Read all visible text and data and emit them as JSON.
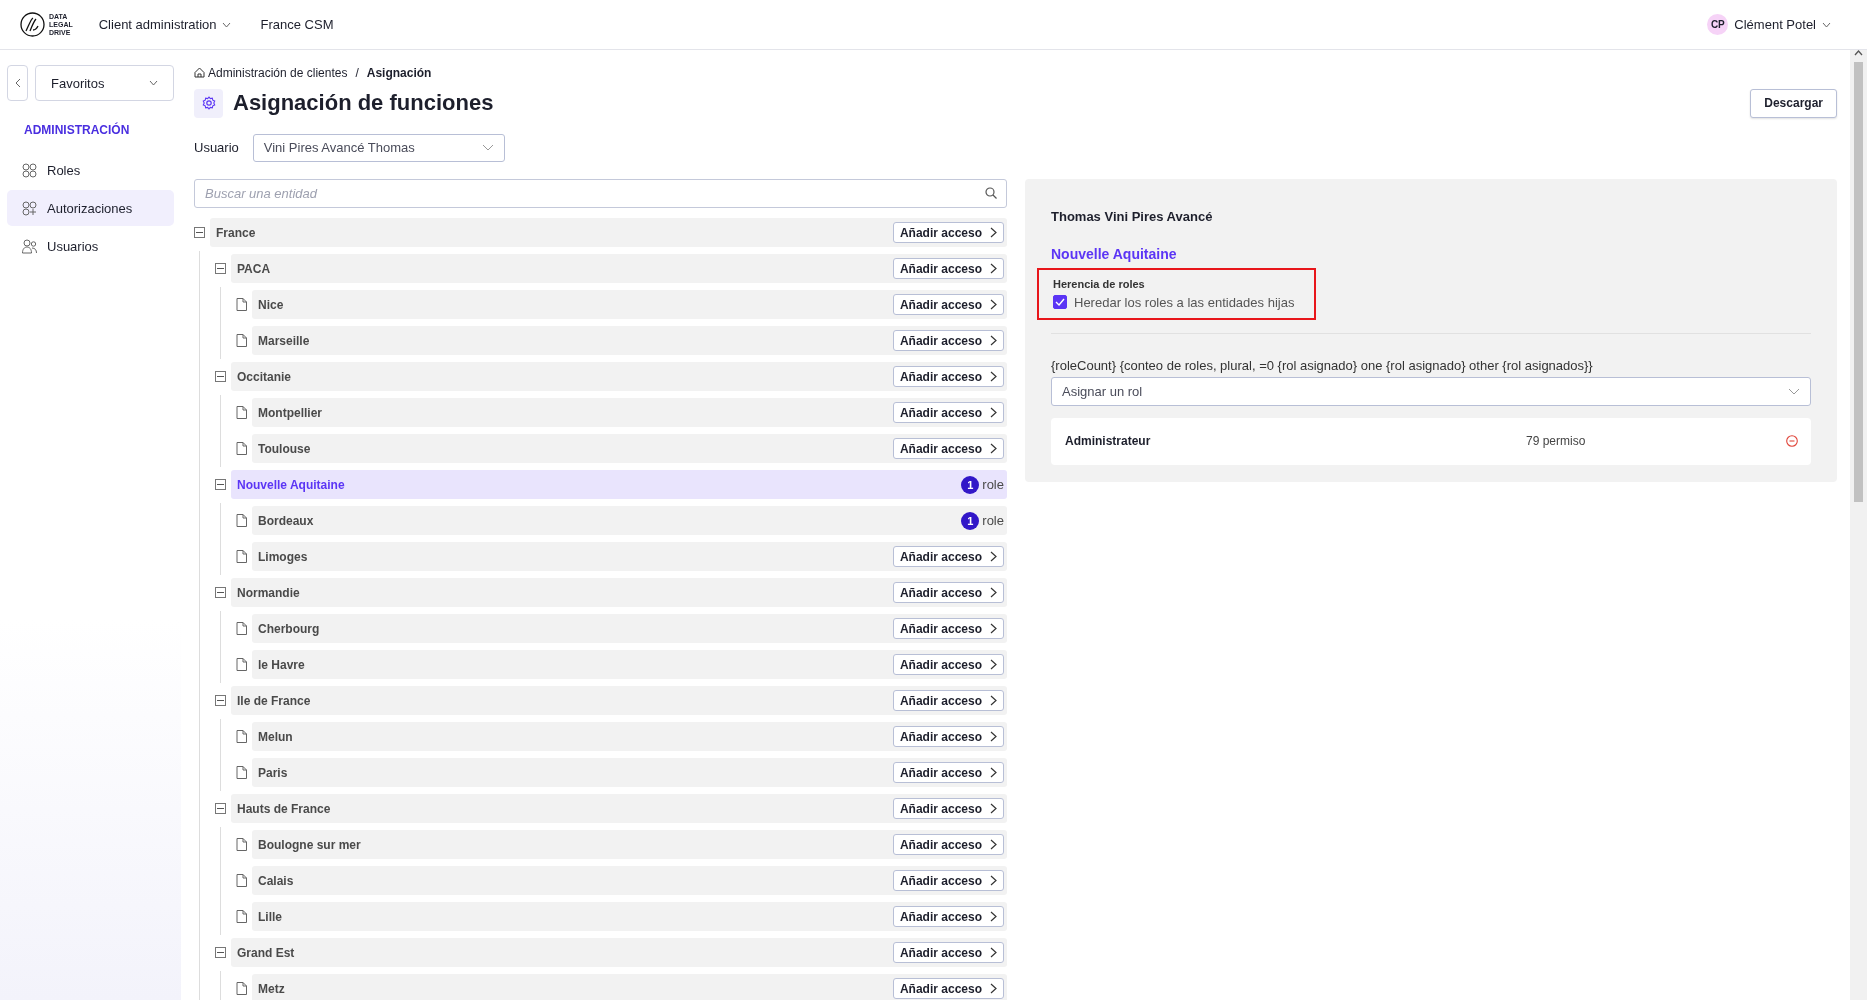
{
  "header": {
    "logo": [
      "DATA",
      "LEGAL",
      "DRIVE"
    ],
    "nav": [
      {
        "label": "Client administration",
        "dropdown": true
      },
      {
        "label": "France CSM",
        "dropdown": false
      }
    ],
    "user": {
      "initials": "CP",
      "name": "Clément Potel"
    }
  },
  "sidebar": {
    "favorites": "Favoritos",
    "section": "ADMINISTRACIÓN",
    "items": [
      {
        "label": "Roles",
        "kind": "roles",
        "selected": false
      },
      {
        "label": "Autorizaciones",
        "kind": "auth",
        "selected": true
      },
      {
        "label": "Usuarios",
        "kind": "users",
        "selected": false
      }
    ]
  },
  "breadcrumb": {
    "items": [
      "Administración de clientes",
      "Asignación"
    ],
    "separator": "/"
  },
  "title": "Asignación de funciones",
  "download_button": "Descargar",
  "user_select": {
    "label": "Usuario",
    "value": "Vini Pires Avancé Thomas"
  },
  "search": {
    "placeholder": "Buscar una entidad"
  },
  "tree": [
    {
      "label": "France",
      "kind": "group",
      "expanded": true,
      "selected": false,
      "action": {
        "kind": "button",
        "label": "Añadir acceso"
      },
      "children": [
        {
          "label": "PACA",
          "kind": "group",
          "expanded": true,
          "selected": false,
          "action": {
            "kind": "button",
            "label": "Añadir acceso"
          },
          "children": [
            {
              "label": "Nice",
              "kind": "leaf",
              "selected": false,
              "action": {
                "kind": "button",
                "label": "Añadir acceso"
              }
            },
            {
              "label": "Marseille",
              "kind": "leaf",
              "selected": false,
              "action": {
                "kind": "button",
                "label": "Añadir acceso"
              }
            }
          ]
        },
        {
          "label": "Occitanie",
          "kind": "group",
          "expanded": true,
          "selected": false,
          "action": {
            "kind": "button",
            "label": "Añadir acceso"
          },
          "children": [
            {
              "label": "Montpellier",
              "kind": "leaf",
              "selected": false,
              "action": {
                "kind": "button",
                "label": "Añadir acceso"
              }
            },
            {
              "label": "Toulouse",
              "kind": "leaf",
              "selected": false,
              "action": {
                "kind": "button",
                "label": "Añadir acceso"
              }
            }
          ]
        },
        {
          "label": "Nouvelle Aquitaine",
          "kind": "group",
          "expanded": true,
          "selected": true,
          "action": {
            "kind": "count",
            "count": "1",
            "unit": "role"
          },
          "children": [
            {
              "label": "Bordeaux",
              "kind": "leaf",
              "selected": false,
              "action": {
                "kind": "count",
                "count": "1",
                "unit": "role"
              }
            },
            {
              "label": "Limoges",
              "kind": "leaf",
              "selected": false,
              "action": {
                "kind": "button",
                "label": "Añadir acceso"
              }
            }
          ]
        },
        {
          "label": "Normandie",
          "kind": "group",
          "expanded": true,
          "selected": false,
          "action": {
            "kind": "button",
            "label": "Añadir acceso"
          },
          "children": [
            {
              "label": "Cherbourg",
              "kind": "leaf",
              "selected": false,
              "action": {
                "kind": "button",
                "label": "Añadir acceso"
              }
            },
            {
              "label": "le Havre",
              "kind": "leaf",
              "selected": false,
              "action": {
                "kind": "button",
                "label": "Añadir acceso"
              }
            }
          ]
        },
        {
          "label": "Ile de France",
          "kind": "group",
          "expanded": true,
          "selected": false,
          "action": {
            "kind": "button",
            "label": "Añadir acceso"
          },
          "children": [
            {
              "label": "Melun",
              "kind": "leaf",
              "selected": false,
              "action": {
                "kind": "button",
                "label": "Añadir acceso"
              }
            },
            {
              "label": "Paris",
              "kind": "leaf",
              "selected": false,
              "action": {
                "kind": "button",
                "label": "Añadir acceso"
              }
            }
          ]
        },
        {
          "label": "Hauts de France",
          "kind": "group",
          "expanded": true,
          "selected": false,
          "action": {
            "kind": "button",
            "label": "Añadir acceso"
          },
          "children": [
            {
              "label": "Boulogne sur mer",
              "kind": "leaf",
              "selected": false,
              "action": {
                "kind": "button",
                "label": "Añadir acceso"
              }
            },
            {
              "label": "Calais",
              "kind": "leaf",
              "selected": false,
              "action": {
                "kind": "button",
                "label": "Añadir acceso"
              }
            },
            {
              "label": "Lille",
              "kind": "leaf",
              "selected": false,
              "action": {
                "kind": "button",
                "label": "Añadir acceso"
              }
            }
          ]
        },
        {
          "label": "Grand Est",
          "kind": "group",
          "expanded": true,
          "selected": false,
          "action": {
            "kind": "button",
            "label": "Añadir acceso"
          },
          "children": [
            {
              "label": "Metz",
              "kind": "leaf",
              "selected": false,
              "action": {
                "kind": "button",
                "label": "Añadir acceso"
              }
            }
          ]
        }
      ]
    }
  ],
  "detail": {
    "user_name": "Thomas Vini Pires Avancé",
    "entity": "Nouvelle Aquitaine",
    "inheritance": {
      "title": "Herencia de roles",
      "label": "Heredar los roles a las entidades hijas",
      "checked": true,
      "highlighted": true
    },
    "role_count_text": "{roleCount} {conteo de roles, plural, =0 {rol asignado} one {rol asignado} other {rol asignados}}",
    "role_select": {
      "placeholder": "Asignar un rol"
    },
    "roles": [
      {
        "name": "Administrateur",
        "permissions": "79 permiso"
      }
    ]
  }
}
